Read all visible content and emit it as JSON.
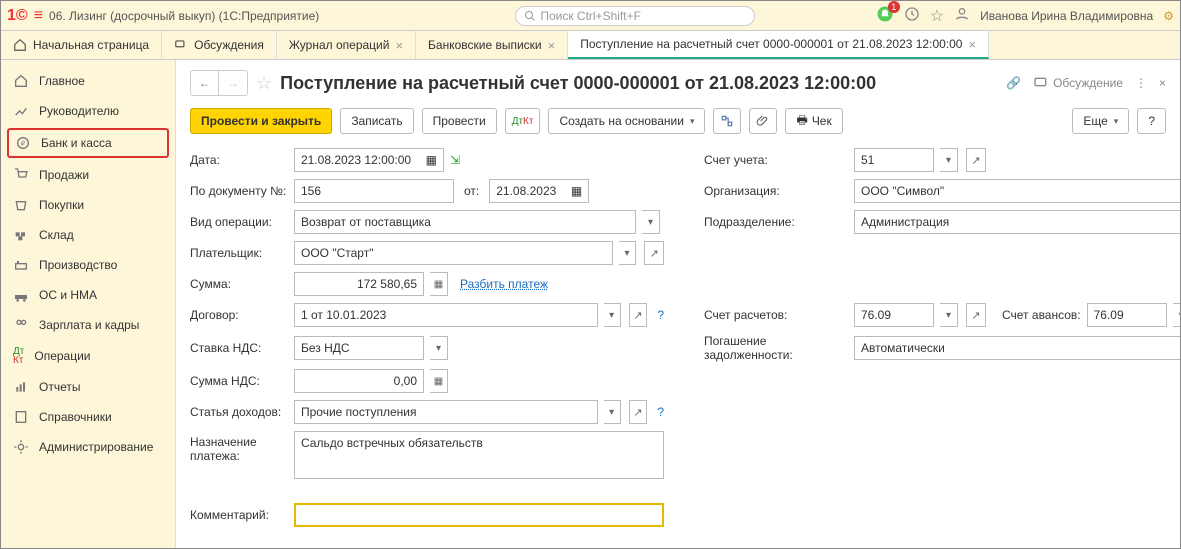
{
  "window": {
    "title": "06. Лизинг (досрочный выкуп)  (1С:Предприятие)"
  },
  "search": {
    "placeholder": "Поиск Ctrl+Shift+F"
  },
  "notifications": {
    "count": "1"
  },
  "user": {
    "name": "Иванова Ирина Владимировна"
  },
  "tabs": {
    "home": "Начальная страница",
    "t1": "Обсуждения",
    "t2": "Журнал операций",
    "t3": "Банковские выписки",
    "t4": "Поступление на расчетный счет 0000-000001 от 21.08.2023 12:00:00"
  },
  "sidebar": {
    "main": "Главное",
    "manager": "Руководителю",
    "bank": "Банк и касса",
    "sales": "Продажи",
    "purch": "Покупки",
    "stock": "Склад",
    "prod": "Производство",
    "os": "ОС и НМА",
    "hr": "Зарплата и кадры",
    "ops": "Операции",
    "rep": "Отчеты",
    "ref": "Справочники",
    "admin": "Администрирование"
  },
  "page": {
    "title": "Поступление на расчетный счет 0000-000001 от 21.08.2023 12:00:00",
    "discuss": "Обсуждение"
  },
  "toolbar": {
    "postclose": "Провести и закрыть",
    "save": "Записать",
    "post": "Провести",
    "createbased": "Создать на основании",
    "cheque": "Чек",
    "more": "Еще",
    "help": "?"
  },
  "labels": {
    "date": "Дата:",
    "account": "Счет учета:",
    "docnum": "По документу №:",
    "from": "от:",
    "org": "Организация:",
    "optype": "Вид операции:",
    "dept": "Подразделение:",
    "payer": "Плательщик:",
    "sum": "Сумма:",
    "split": "Разбить платеж",
    "contract": "Договор:",
    "calcacct": "Счет расчетов:",
    "advacct": "Счет авансов:",
    "vat": "Ставка НДС:",
    "debt": "Погашение задолженности:",
    "vatsum": "Сумма НДС:",
    "income": "Статья доходов:",
    "purpose": "Назначение платежа:",
    "comment": "Комментарий:"
  },
  "values": {
    "date": "21.08.2023 12:00:00",
    "account": "51",
    "docnum": "156",
    "fromdate": "21.08.2023",
    "org": "ООО \"Символ\"",
    "optype": "Возврат от поставщика",
    "dept": "Администрация",
    "payer": "ООО \"Старт\"",
    "sum": "172 580,65",
    "contract": "1 от 10.01.2023",
    "calcacct": "76.09",
    "advacct": "76.09",
    "vat": "Без НДС",
    "debt": "Автоматически",
    "vatsum": "0,00",
    "income": "Прочие поступления",
    "purpose": "Сальдо встречных обязательств",
    "comment": ""
  }
}
